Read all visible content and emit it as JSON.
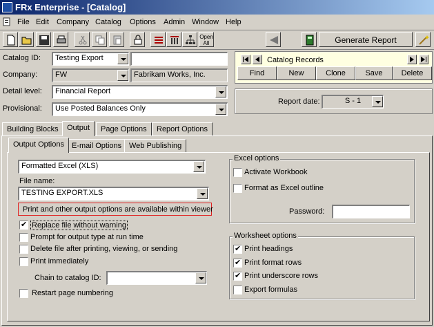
{
  "window": {
    "title": "FRx Enterprise - [Catalog]"
  },
  "menu": [
    "File",
    "Edit",
    "Company",
    "Catalog",
    "Options",
    "Admin",
    "Window",
    "Help"
  ],
  "toolbar": {
    "generate_report": "Generate Report",
    "open_all": "Open All"
  },
  "catalog": {
    "catalog_id_label": "Catalog ID:",
    "catalog_id_value": "Testing Export",
    "catalog_desc_value": "",
    "company_label": "Company:",
    "company_code": "FW",
    "company_name": "Fabrikam Works, Inc.",
    "detail_label": "Detail level:",
    "detail_value": "Financial Report",
    "provisional_label": "Provisional:",
    "provisional_value": "Use Posted Balances Only"
  },
  "records": {
    "title": "Catalog Records",
    "buttons": [
      "Find",
      "New",
      "Clone",
      "Save",
      "Delete"
    ]
  },
  "report_date": {
    "label": "Report date:",
    "value": "S - 1"
  },
  "main_tabs": [
    "Building Blocks",
    "Output",
    "Page Options",
    "Report Options"
  ],
  "sub_tabs": [
    "Output Options",
    "E-mail Options",
    "Web Publishing"
  ],
  "output": {
    "format_value": "Formatted Excel (XLS)",
    "file_name_label": "File name:",
    "file_name_value": "TESTING EXPORT.XLS",
    "notice": "Print and other output options are available within viewer",
    "checks": [
      {
        "label": "Replace file without warning",
        "checked": true
      },
      {
        "label": "Prompt for output type at run time",
        "checked": false
      },
      {
        "label": "Delete file after printing, viewing, or sending",
        "checked": false
      },
      {
        "label": "Print immediately",
        "checked": false
      }
    ],
    "chain_label": "Chain to catalog ID:",
    "chain_value": "",
    "restart_label": "Restart page numbering",
    "restart_checked": false
  },
  "excel_options": {
    "title": "Excel options",
    "checks": [
      {
        "label": "Activate Workbook",
        "checked": false
      },
      {
        "label": "Format as Excel outline",
        "checked": false
      }
    ],
    "password_label": "Password:",
    "password_value": ""
  },
  "worksheet_options": {
    "title": "Worksheet options",
    "checks": [
      {
        "label": "Print headings",
        "checked": true
      },
      {
        "label": "Print format rows",
        "checked": true
      },
      {
        "label": "Print underscore rows",
        "checked": true
      },
      {
        "label": "Export formulas",
        "checked": false
      }
    ]
  }
}
